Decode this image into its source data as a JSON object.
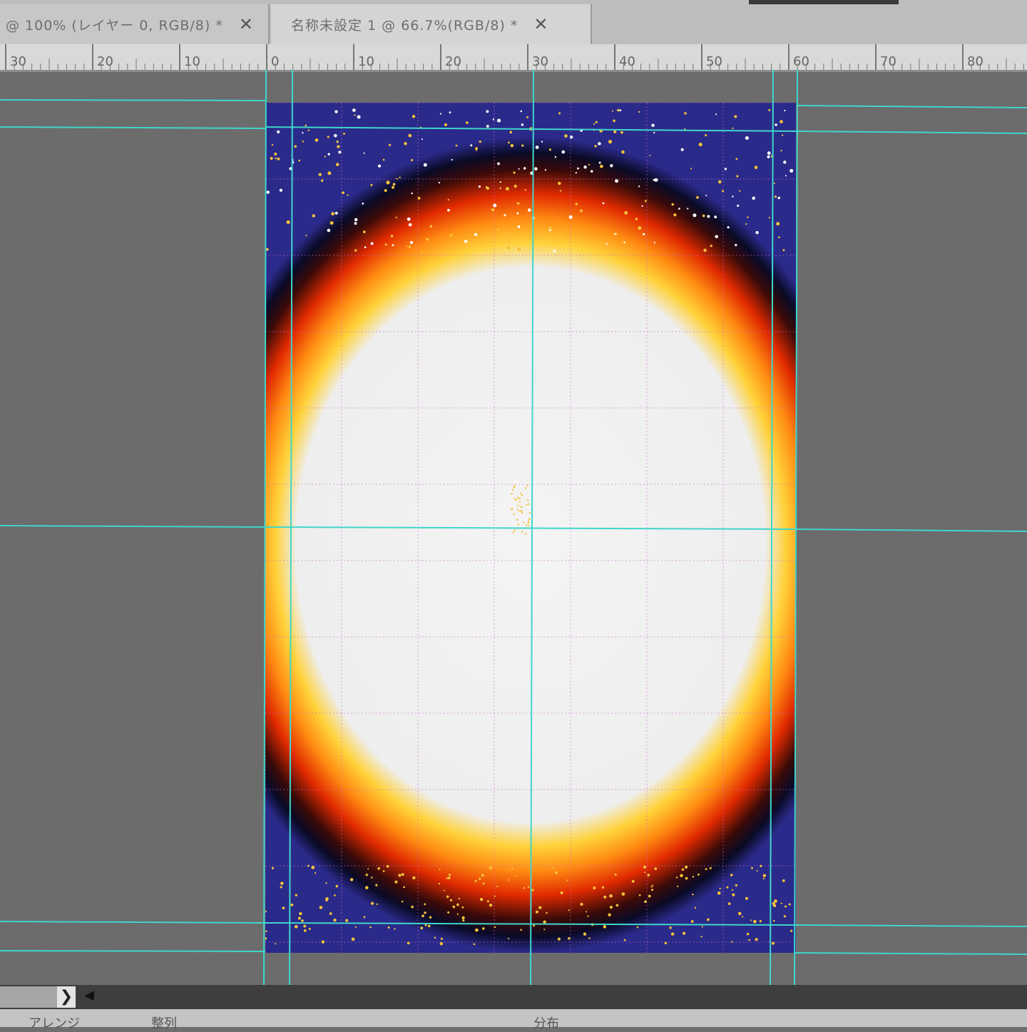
{
  "tabs": [
    {
      "label": "@ 100% (レイヤー 0, RGB/8) *",
      "close": "✕"
    },
    {
      "label": "名称未設定 1 @ 66.7%(RGB/8) *",
      "close": "✕"
    }
  ],
  "ruler": {
    "labels": [
      "30",
      "20",
      "10",
      "0",
      "10",
      "20",
      "30",
      "40",
      "50",
      "60",
      "70",
      "80"
    ]
  },
  "scrollbar": {
    "next_glyph": "❯",
    "prev_glyph": "◀"
  },
  "bottom_panel": {
    "labels": [
      "アレンジ",
      "整列",
      "分布"
    ]
  },
  "colors": {
    "guide": "#3fd6cc",
    "grid": "#c86ad0",
    "canvas_bg": "#6c6c6c",
    "star_white": "#ffffff",
    "star_gold": "#f5c23a"
  }
}
